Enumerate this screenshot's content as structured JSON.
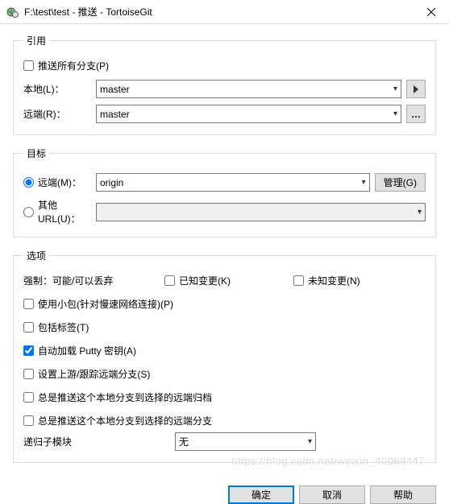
{
  "window": {
    "title": "F:\\test\\test - 推送 - TortoiseGit"
  },
  "ref": {
    "legend": "引用",
    "push_all_label": "推送所有分支(P)",
    "push_all_checked": false,
    "local_label": "本地(L)：",
    "local_value": "master",
    "remote_label": "远端(R)：",
    "remote_value": "master"
  },
  "dest": {
    "legend": "目标",
    "remote_radio_label": "远端(M)：",
    "remote_radio_checked": true,
    "remote_value": "origin",
    "manage_label": "管理(G)",
    "other_url_radio_label": "其他URL(U)：",
    "other_url_radio_checked": false,
    "other_url_value": ""
  },
  "options": {
    "legend": "选项",
    "force_label": "强制：可能/可以丢弃",
    "force_checked": false,
    "known_changes_label": "已知变更(K)",
    "known_changes_checked": false,
    "unknown_changes_label": "未知变更(N)",
    "unknown_changes_checked": false,
    "thin_pack_label": "使用小包(针对慢速网络连接)(P)",
    "thin_pack_checked": false,
    "include_tags_label": "包括标签(T)",
    "include_tags_checked": false,
    "autoload_putty_label": "自动加载 Putty 密钥(A)",
    "autoload_putty_checked": true,
    "set_upstream_label": "设置上游/跟踪远端分支(S)",
    "set_upstream_checked": false,
    "always_push_archive_label": "总是推送这个本地分支到选择的远端归档",
    "always_push_archive_checked": false,
    "always_push_branch_label": "总是推送这个本地分支到选择的远端分支",
    "always_push_branch_checked": false,
    "recurse_sub_label": "递归子模块",
    "recurse_sub_value": "无"
  },
  "footer": {
    "ok": "确定",
    "cancel": "取消",
    "help": "帮助"
  },
  "watermark": "https://blog.csdn.net/weixin_40069447"
}
